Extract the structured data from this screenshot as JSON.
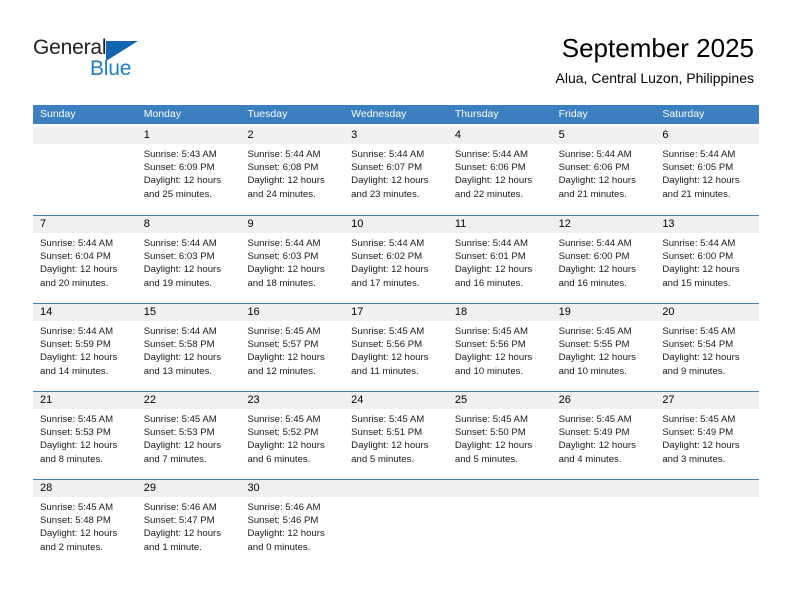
{
  "logo": {
    "text_top": "General",
    "text_bottom": "Blue",
    "triangle_color": "#1266b0",
    "bottom_color": "#1e7fc4"
  },
  "header": {
    "title": "September 2025",
    "subtitle": "Alua, Central Luzon, Philippines"
  },
  "theme": {
    "header_bar_color": "#3c7fc1",
    "day_band_color": "#f0f0f0",
    "row_border_color": "#3c7fc1"
  },
  "weekdays": [
    "Sunday",
    "Monday",
    "Tuesday",
    "Wednesday",
    "Thursday",
    "Friday",
    "Saturday"
  ],
  "weeks": [
    [
      {
        "day": "",
        "lines": []
      },
      {
        "day": "1",
        "lines": [
          "Sunrise: 5:43 AM",
          "Sunset: 6:09 PM",
          "Daylight: 12 hours",
          "and 25 minutes."
        ]
      },
      {
        "day": "2",
        "lines": [
          "Sunrise: 5:44 AM",
          "Sunset: 6:08 PM",
          "Daylight: 12 hours",
          "and 24 minutes."
        ]
      },
      {
        "day": "3",
        "lines": [
          "Sunrise: 5:44 AM",
          "Sunset: 6:07 PM",
          "Daylight: 12 hours",
          "and 23 minutes."
        ]
      },
      {
        "day": "4",
        "lines": [
          "Sunrise: 5:44 AM",
          "Sunset: 6:06 PM",
          "Daylight: 12 hours",
          "and 22 minutes."
        ]
      },
      {
        "day": "5",
        "lines": [
          "Sunrise: 5:44 AM",
          "Sunset: 6:06 PM",
          "Daylight: 12 hours",
          "and 21 minutes."
        ]
      },
      {
        "day": "6",
        "lines": [
          "Sunrise: 5:44 AM",
          "Sunset: 6:05 PM",
          "Daylight: 12 hours",
          "and 21 minutes."
        ]
      }
    ],
    [
      {
        "day": "7",
        "lines": [
          "Sunrise: 5:44 AM",
          "Sunset: 6:04 PM",
          "Daylight: 12 hours",
          "and 20 minutes."
        ]
      },
      {
        "day": "8",
        "lines": [
          "Sunrise: 5:44 AM",
          "Sunset: 6:03 PM",
          "Daylight: 12 hours",
          "and 19 minutes."
        ]
      },
      {
        "day": "9",
        "lines": [
          "Sunrise: 5:44 AM",
          "Sunset: 6:03 PM",
          "Daylight: 12 hours",
          "and 18 minutes."
        ]
      },
      {
        "day": "10",
        "lines": [
          "Sunrise: 5:44 AM",
          "Sunset: 6:02 PM",
          "Daylight: 12 hours",
          "and 17 minutes."
        ]
      },
      {
        "day": "11",
        "lines": [
          "Sunrise: 5:44 AM",
          "Sunset: 6:01 PM",
          "Daylight: 12 hours",
          "and 16 minutes."
        ]
      },
      {
        "day": "12",
        "lines": [
          "Sunrise: 5:44 AM",
          "Sunset: 6:00 PM",
          "Daylight: 12 hours",
          "and 16 minutes."
        ]
      },
      {
        "day": "13",
        "lines": [
          "Sunrise: 5:44 AM",
          "Sunset: 6:00 PM",
          "Daylight: 12 hours",
          "and 15 minutes."
        ]
      }
    ],
    [
      {
        "day": "14",
        "lines": [
          "Sunrise: 5:44 AM",
          "Sunset: 5:59 PM",
          "Daylight: 12 hours",
          "and 14 minutes."
        ]
      },
      {
        "day": "15",
        "lines": [
          "Sunrise: 5:44 AM",
          "Sunset: 5:58 PM",
          "Daylight: 12 hours",
          "and 13 minutes."
        ]
      },
      {
        "day": "16",
        "lines": [
          "Sunrise: 5:45 AM",
          "Sunset: 5:57 PM",
          "Daylight: 12 hours",
          "and 12 minutes."
        ]
      },
      {
        "day": "17",
        "lines": [
          "Sunrise: 5:45 AM",
          "Sunset: 5:56 PM",
          "Daylight: 12 hours",
          "and 11 minutes."
        ]
      },
      {
        "day": "18",
        "lines": [
          "Sunrise: 5:45 AM",
          "Sunset: 5:56 PM",
          "Daylight: 12 hours",
          "and 10 minutes."
        ]
      },
      {
        "day": "19",
        "lines": [
          "Sunrise: 5:45 AM",
          "Sunset: 5:55 PM",
          "Daylight: 12 hours",
          "and 10 minutes."
        ]
      },
      {
        "day": "20",
        "lines": [
          "Sunrise: 5:45 AM",
          "Sunset: 5:54 PM",
          "Daylight: 12 hours",
          "and 9 minutes."
        ]
      }
    ],
    [
      {
        "day": "21",
        "lines": [
          "Sunrise: 5:45 AM",
          "Sunset: 5:53 PM",
          "Daylight: 12 hours",
          "and 8 minutes."
        ]
      },
      {
        "day": "22",
        "lines": [
          "Sunrise: 5:45 AM",
          "Sunset: 5:53 PM",
          "Daylight: 12 hours",
          "and 7 minutes."
        ]
      },
      {
        "day": "23",
        "lines": [
          "Sunrise: 5:45 AM",
          "Sunset: 5:52 PM",
          "Daylight: 12 hours",
          "and 6 minutes."
        ]
      },
      {
        "day": "24",
        "lines": [
          "Sunrise: 5:45 AM",
          "Sunset: 5:51 PM",
          "Daylight: 12 hours",
          "and 5 minutes."
        ]
      },
      {
        "day": "25",
        "lines": [
          "Sunrise: 5:45 AM",
          "Sunset: 5:50 PM",
          "Daylight: 12 hours",
          "and 5 minutes."
        ]
      },
      {
        "day": "26",
        "lines": [
          "Sunrise: 5:45 AM",
          "Sunset: 5:49 PM",
          "Daylight: 12 hours",
          "and 4 minutes."
        ]
      },
      {
        "day": "27",
        "lines": [
          "Sunrise: 5:45 AM",
          "Sunset: 5:49 PM",
          "Daylight: 12 hours",
          "and 3 minutes."
        ]
      }
    ],
    [
      {
        "day": "28",
        "lines": [
          "Sunrise: 5:45 AM",
          "Sunset: 5:48 PM",
          "Daylight: 12 hours",
          "and 2 minutes."
        ]
      },
      {
        "day": "29",
        "lines": [
          "Sunrise: 5:46 AM",
          "Sunset: 5:47 PM",
          "Daylight: 12 hours",
          "and 1 minute."
        ]
      },
      {
        "day": "30",
        "lines": [
          "Sunrise: 5:46 AM",
          "Sunset: 5:46 PM",
          "Daylight: 12 hours",
          "and 0 minutes."
        ]
      },
      {
        "day": "",
        "lines": []
      },
      {
        "day": "",
        "lines": []
      },
      {
        "day": "",
        "lines": []
      },
      {
        "day": "",
        "lines": []
      }
    ]
  ]
}
